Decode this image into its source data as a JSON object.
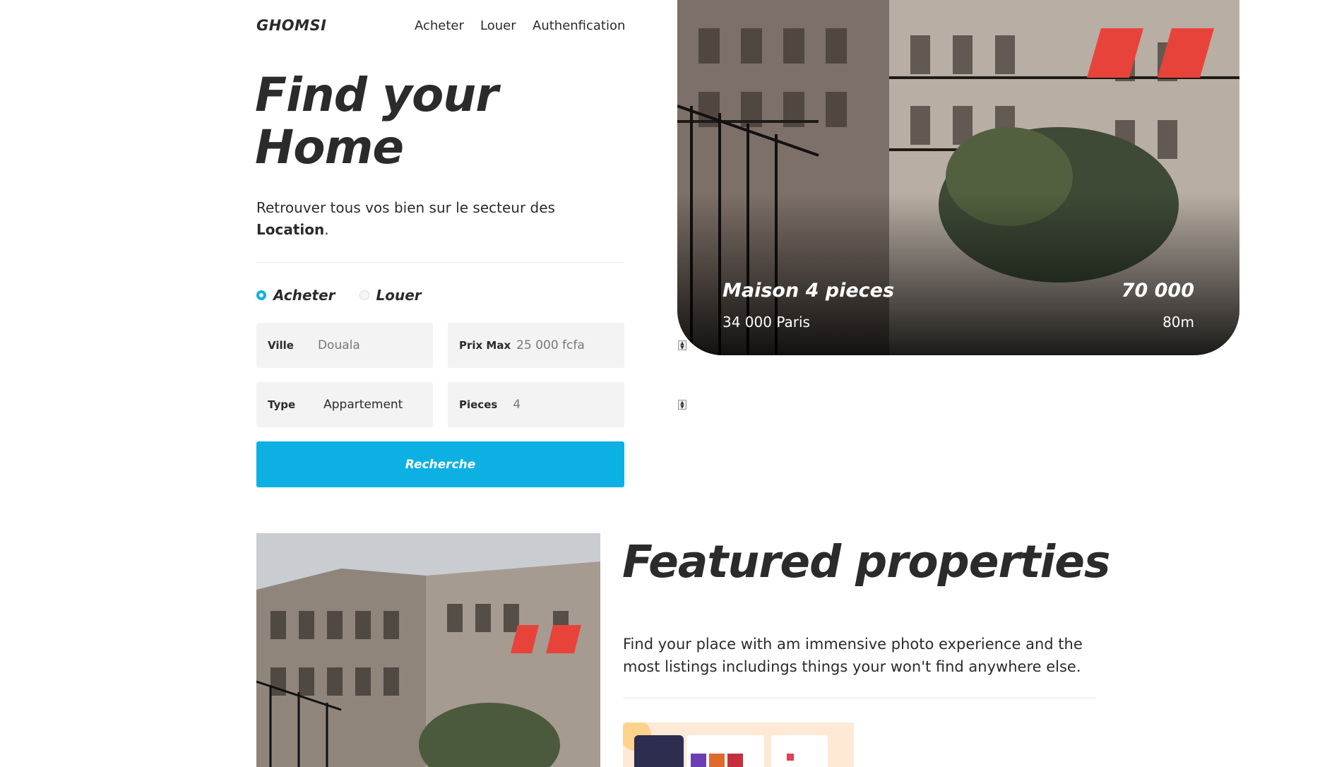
{
  "header": {
    "brand": "GHOMSI",
    "nav": [
      "Acheter",
      "Louer",
      "Authenfication"
    ]
  },
  "hero": {
    "title_line1": "Find your",
    "title_line2": "Home",
    "subtitle_text": "Retrouver tous vos bien sur le secteur des",
    "subtitle_bold": "Location",
    "subtitle_end": "."
  },
  "search": {
    "modes": [
      {
        "label": "Acheter",
        "selected": true
      },
      {
        "label": "Louer",
        "selected": false
      }
    ],
    "fields": {
      "ville": {
        "label": "Ville",
        "value": "Douala"
      },
      "prix": {
        "label": "Prix Max",
        "value": "25 000 fcfa"
      },
      "type": {
        "label": "Type",
        "value": "Appartement"
      },
      "pieces": {
        "label": "Pieces",
        "value": "4"
      }
    },
    "button": "Recherche"
  },
  "hero_card": {
    "name": "Maison 4 pieces",
    "location": "34 000 Paris",
    "price": "70 000",
    "area": "80m"
  },
  "featured": {
    "title": "Featured properties",
    "text": "Find your place with am immensive photo experience and the most listings includings things your won't find anywhere else."
  },
  "colors": {
    "accent": "#0db0e3",
    "text": "#2b2b2b",
    "field_bg": "#f3f3f3"
  }
}
